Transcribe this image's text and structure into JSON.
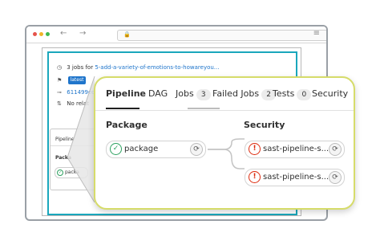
{
  "browser": {
    "back_glyph": "←",
    "forward_glyph": "→",
    "lock_glyph": "🔒",
    "menu_glyph": "≡"
  },
  "info": {
    "jobs_prefix": "3 jobs for",
    "branch_link": "5-add-a-variety-of-emotions-to-howareyou...",
    "latest_badge": "latest",
    "commit": "611499ed",
    "related": "No relat"
  },
  "mini": {
    "tab": "Pipeline",
    "stage": "Packa",
    "job": "packa"
  },
  "tabs": [
    {
      "label": "Pipeline",
      "active": true
    },
    {
      "label": "DAG"
    },
    {
      "label": "Jobs",
      "count": "3"
    },
    {
      "label": "Failed Jobs",
      "count": "2"
    },
    {
      "label": "Tests",
      "count": "0"
    },
    {
      "label": "Security"
    }
  ],
  "stages": [
    {
      "title": "Package",
      "jobs": [
        {
          "name": "package",
          "status": "success"
        }
      ]
    },
    {
      "title": "Security",
      "jobs": [
        {
          "name": "sast-pipeline-s...",
          "status": "failed"
        },
        {
          "name": "sast-pipeline-s...",
          "status": "failed"
        }
      ]
    }
  ],
  "glyphs": {
    "success": "✓",
    "failed": "!",
    "retry": "⟳"
  },
  "colors": {
    "accent_frame": "#1aa7bc",
    "callout_border": "#d6dc6a",
    "link": "#1f75cb",
    "success": "#2da160",
    "failed": "#dd2b0e"
  }
}
